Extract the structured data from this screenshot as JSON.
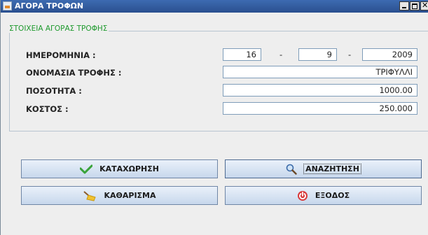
{
  "window": {
    "title": "ΑΓΟΡΑ ΤΡΟΦΩΝ"
  },
  "group": {
    "title": "ΣΤΟΙΧΕΙΑ ΑΓΟΡΑΣ ΤΡΟΦΗΣ"
  },
  "form": {
    "date_label": "ΗΜΕΡΟΜΗΝΙΑ :",
    "day": "16",
    "month": "9",
    "year": "2009",
    "date_separator": "-",
    "name_label": "ΟΝΟΜΑΣΙΑ ΤΡΟΦΗΣ :",
    "name_value": "ΤΡΙΦΥΛΛΙ",
    "quantity_label": "ΠΟΣΟΤΗΤΑ :",
    "quantity_value": "1000.00",
    "cost_label": "ΚΟΣΤΟΣ :",
    "cost_value": "250.000"
  },
  "buttons": {
    "save": "ΚΑΤΑΧΩΡΗΣΗ",
    "search": "ΑΝΑΖΗΤΗΣΗ",
    "clear": "ΚΑΘΑΡΙΣΜΑ",
    "exit": "ΕΞΟΔΟΣ"
  },
  "icons": {
    "save": "checkmark-icon",
    "search": "magnifier-icon",
    "clear": "broom-icon",
    "exit": "exit-icon"
  }
}
